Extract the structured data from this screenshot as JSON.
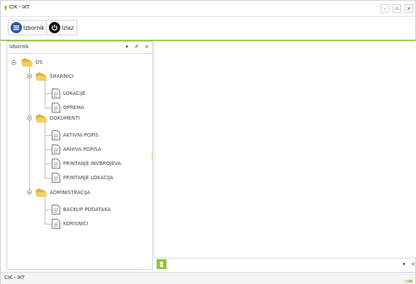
{
  "window": {
    "title": "CIK - IKT",
    "controls": {
      "minimize": "–",
      "maximize": "▫",
      "close": "×"
    }
  },
  "toolbar": {
    "buttons": [
      {
        "label": "Izbornik",
        "icon": "menu-list-icon",
        "color": "#2b5aa8"
      },
      {
        "label": "Izlaz",
        "icon": "power-icon",
        "color": "#111111"
      }
    ]
  },
  "panel": {
    "title": "Izbornik",
    "buttons": {
      "dropdown": "▾",
      "pin": "✐",
      "close": "×"
    },
    "tree": {
      "root": "OS",
      "groups": [
        {
          "label": "ŠIFARNICI",
          "items": [
            "LOKACIJE",
            "OPREMA"
          ]
        },
        {
          "label": "DOKUMENTI",
          "items": [
            "AKTIVNI POPIS",
            "ARHIVA POPISA",
            "PRINTANJE INVBROJEVA",
            "PRINTANJE LOKACIJA"
          ]
        },
        {
          "label": "ADMINISTRACIJA",
          "items": [
            "BACKUP PODATAKA",
            "KORISNICI"
          ]
        }
      ]
    }
  },
  "bottombar": {
    "buttons": {
      "dropdown": "▾",
      "close": "×"
    }
  },
  "statusbar": {
    "text": "CIK - IKT"
  },
  "colors": {
    "accent": "#8dc63f",
    "folder": "#e2b23a"
  }
}
